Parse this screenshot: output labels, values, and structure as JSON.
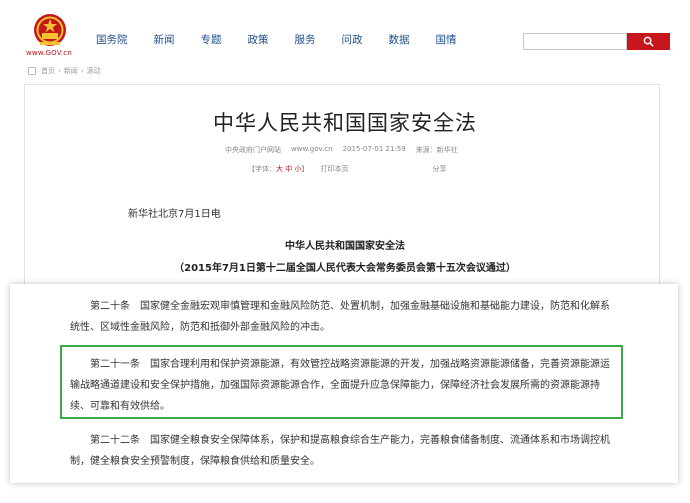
{
  "header": {
    "logo_text": "www.GOV.cn",
    "nav": [
      "国务院",
      "新闻",
      "专题",
      "政策",
      "服务",
      "问政",
      "数据",
      "国情"
    ],
    "search": {
      "placeholder": ""
    }
  },
  "breadcrumb": [
    "首页",
    "新闻",
    "滚动"
  ],
  "article": {
    "title": "中华人民共和国国家安全法",
    "source_site": "中央政府门户网站",
    "site_url": "www.gov.cn",
    "datetime": "2015-07-01 21:59",
    "source": "来源：新华社",
    "font_size_label": "【字体：",
    "font_sizes": [
      "大",
      "中",
      "小"
    ],
    "font_size_close": "】",
    "print_label": "打印本页",
    "share_label": "分享",
    "dateline": "新华社北京7月1日电",
    "law_title": "中华人民共和国国家安全法",
    "law_subtitle": "（2015年7月1日第十二届全国人民代表大会常务委员会第十五次会议通过）"
  },
  "articles": [
    "第二十条　国家健全金融宏观审慎管理和金融风险防范、处置机制，加强金融基础设施和基础能力建设，防范和化解系统性、区域性金融风险，防范和抵御外部金融风险的冲击。",
    "第二十一条　国家合理利用和保护资源能源，有效管控战略资源能源的开发，加强战略资源能源储备，完善资源能源运输战略通道建设和安全保护措施，加强国际资源能源合作，全面提升应急保障能力，保障经济社会发展所需的资源能源持续、可靠和有效供给。",
    "第二十二条　国家健全粮食安全保障体系，保护和提高粮食综合生产能力，完善粮食储备制度、流通体系和市场调控机制，健全粮食安全预警制度，保障粮食供给和质量安全。"
  ],
  "colors": {
    "brand_red": "#c8161d",
    "nav_blue": "#1f4e8c",
    "highlight_green": "#3daa4a"
  }
}
